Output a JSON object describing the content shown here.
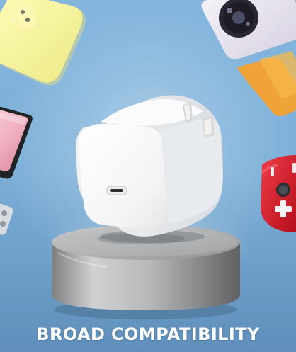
{
  "scene": {
    "caption": "BROAD COMPATIBILITY",
    "background_color": "#79abd6",
    "pedestal_color": "#c6c7c8",
    "charger_color": "#f7f7f7",
    "device_colors": {
      "yellow_phone": "#f3f19a",
      "camera_phone": "#ebe5f3",
      "tablet": "#f2b7c6",
      "red_controller": "#d91f2f"
    },
    "icons": [
      "usb-c-port-icon",
      "charger-prongs-icon",
      "camera-module-icon",
      "joystick-icon",
      "dpad-icon"
    ]
  }
}
